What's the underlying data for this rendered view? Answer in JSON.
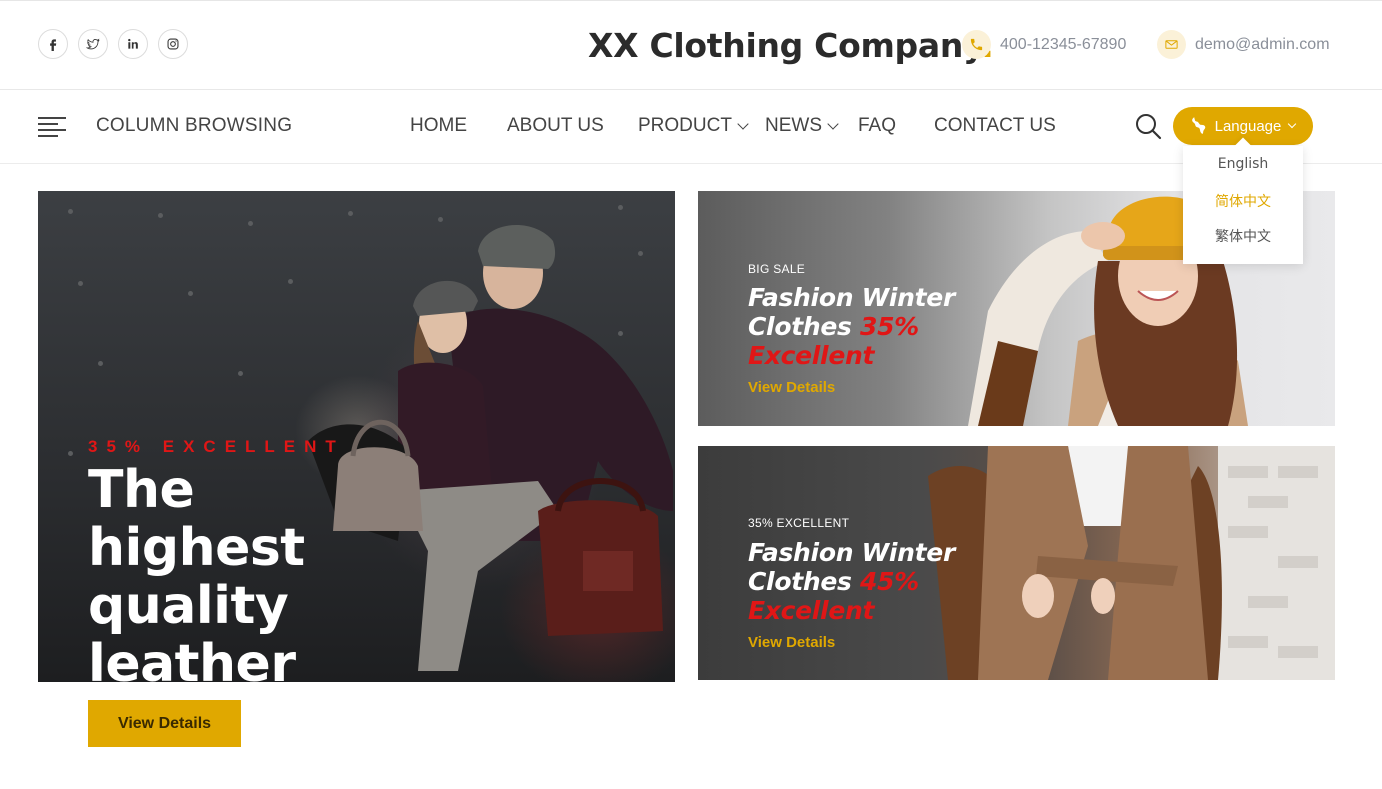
{
  "header": {
    "brand_name": "XX Clothing Company",
    "brand_dot": ".",
    "phone": "400-12345-67890",
    "email": "demo@admin.com",
    "social": [
      {
        "icon": "facebook-icon"
      },
      {
        "icon": "twitter-icon"
      },
      {
        "icon": "linkedin-icon"
      },
      {
        "icon": "instagram-icon"
      }
    ]
  },
  "nav": {
    "column_browsing": "COLUMN BROWSING",
    "items": [
      {
        "label": "HOME"
      },
      {
        "label": "ABOUT US"
      },
      {
        "label": "PRODUCT"
      },
      {
        "label": "NEWS"
      },
      {
        "label": "FAQ"
      },
      {
        "label": "CONTACT US"
      }
    ],
    "language_label": "Language",
    "languages": [
      {
        "label": "English",
        "color": "#555555"
      },
      {
        "label": "简体中文",
        "color": "#e0a800"
      },
      {
        "label": "繁体中文",
        "color": "#555555"
      }
    ]
  },
  "hero": {
    "kicker": "35% EXCELLENT",
    "headline": [
      "The",
      "highest",
      "quality",
      "leather"
    ],
    "button": "View Details"
  },
  "banners": [
    {
      "tag": "BIG SALE",
      "title_line1": "Fashion Winter",
      "title_line2_a": "Clothes ",
      "title_line2_b": "35%",
      "title_line3": "Excellent",
      "link": "View Details"
    },
    {
      "tag": "35% EXCELLENT",
      "title_line1": "Fashion Winter",
      "title_line2_a": "Clothes ",
      "title_line2_b": "45%",
      "title_line3": "Excellent",
      "link": "View Details"
    }
  ],
  "colors": {
    "accent": "#e0a800",
    "sale_red": "#e01616",
    "text_dark": "#2b2b2b",
    "nav_text": "#444444",
    "contact_text": "#8a8f99"
  }
}
